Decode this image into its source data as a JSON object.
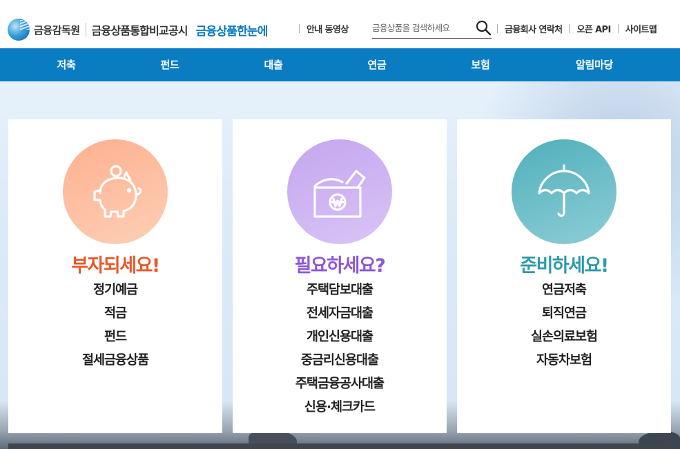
{
  "header": {
    "logo_org": "금융감독원",
    "logo_site": "금융상품통합비교공시",
    "logo_brand": "금융상품한눈에",
    "guide_link": "안내 동영상",
    "search_placeholder": "금융상품을 검색하세요",
    "links": [
      "금융회사 연락처",
      "오픈 API",
      "사이트맵"
    ]
  },
  "nav": {
    "items": [
      "저축",
      "펀드",
      "대출",
      "연금",
      "보험",
      "알림마당"
    ]
  },
  "cards": [
    {
      "title": "부자되세요!",
      "icon": "piggy-bank-icon",
      "color": "#e8582a",
      "circle_from": "#ffb08f",
      "circle_to": "#fccfb6",
      "items": [
        "정기예금",
        "적금",
        "펀드",
        "절세금융상품"
      ]
    },
    {
      "title": "필요하세요?",
      "icon": "wallet-won-icon",
      "color": "#8d57d6",
      "circle_from": "#c4a6ef",
      "circle_to": "#d9c4f6",
      "items": [
        "주택담보대출",
        "전세자금대출",
        "개인신용대출",
        "중금리신용대출",
        "주택금융공사대출",
        "신용·체크카드"
      ]
    },
    {
      "title": "준비하세요!",
      "icon": "umbrella-icon",
      "color": "#2e9aa8",
      "circle_from": "#4fb0bb",
      "circle_to": "#8dcdd6",
      "items": [
        "연금저축",
        "퇴직연금",
        "실손의료보험",
        "자동차보험"
      ]
    }
  ]
}
